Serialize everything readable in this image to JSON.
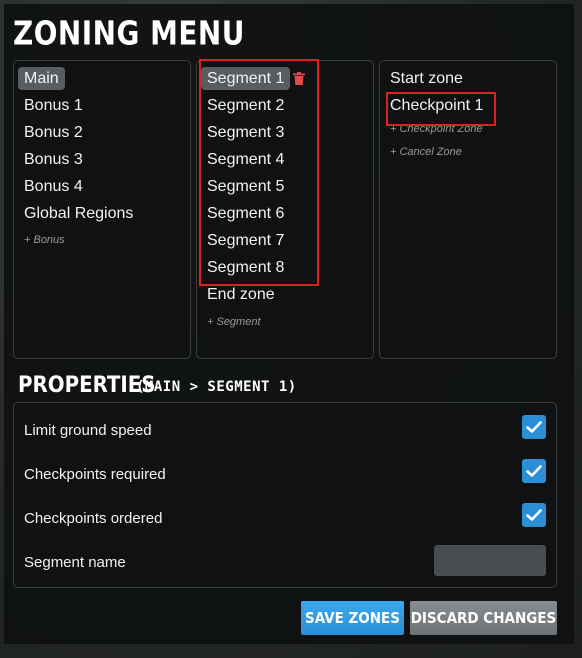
{
  "title": "ZONING MENU",
  "tracks": {
    "items": [
      "Main",
      "Bonus 1",
      "Bonus 2",
      "Bonus 3",
      "Bonus 4",
      "Global Regions"
    ],
    "add_label": "+ Bonus"
  },
  "segments": {
    "items": [
      "Segment 1",
      "Segment 2",
      "Segment 3",
      "Segment 4",
      "Segment 5",
      "Segment 6",
      "Segment 7",
      "Segment 8",
      "End zone"
    ],
    "add_label": "+ Segment"
  },
  "zones": {
    "items": [
      "Start zone",
      "Checkpoint 1"
    ],
    "add_checkpoint": "+ Checkpoint Zone",
    "cancel_zone": "+ Cancel Zone"
  },
  "properties": {
    "title": "PROPERTIES",
    "subtitle": "(MAIN > SEGMENT 1)",
    "limit_ground_speed": "Limit ground speed",
    "checkpoints_required": "Checkpoints required",
    "checkpoints_ordered": "Checkpoints ordered",
    "segment_name": "Segment name",
    "segment_name_value": ""
  },
  "buttons": {
    "save": "SAVE ZONES",
    "discard": "DISCARD CHANGES"
  },
  "colors": {
    "accent": "#2a8fd6",
    "highlight_box": "#e02020",
    "delete_icon": "#e24a4a"
  }
}
